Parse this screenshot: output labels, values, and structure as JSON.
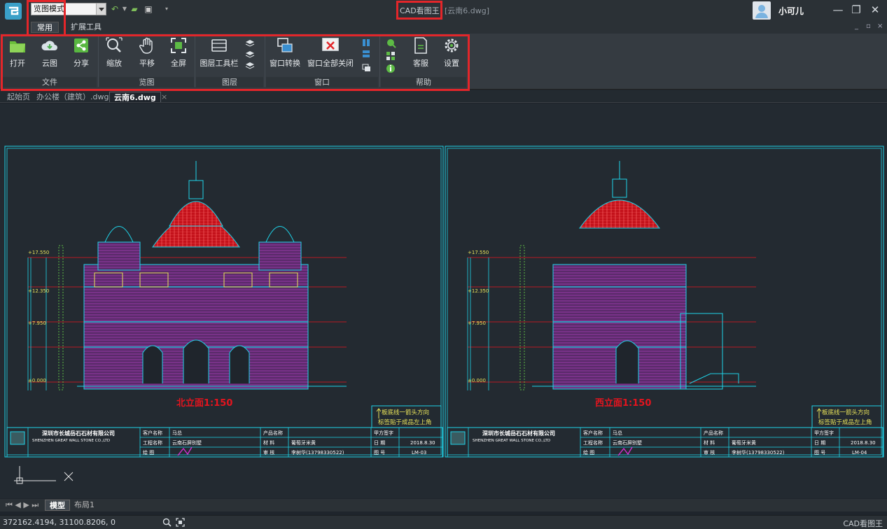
{
  "titlebar": {
    "mode": "览图模式",
    "app_name": "CAD看图王",
    "doc_name": "[云南6.dwg]",
    "username": "小可儿",
    "minimize": "—",
    "restore": "❐",
    "close": "✕"
  },
  "tabs": {
    "common": "常用",
    "extend": "扩展工具"
  },
  "ribbon": {
    "groups": [
      {
        "label": "文件",
        "buttons": [
          "打开",
          "云图",
          "分享"
        ]
      },
      {
        "label": "览图",
        "buttons": [
          "缩放",
          "平移",
          "全屏"
        ]
      },
      {
        "label": "图层",
        "buttons": [
          "图层工具栏"
        ]
      },
      {
        "label": "窗口",
        "buttons": [
          "窗口转换",
          "窗口全部关闭"
        ]
      },
      {
        "label": "帮助",
        "buttons": [
          "客服",
          "设置"
        ]
      }
    ]
  },
  "doc_tabs": [
    "起始页",
    "办公楼（建筑）.dwg",
    "云南6.dwg"
  ],
  "drawing": {
    "left": {
      "title": "北立面1:150",
      "note_line1": "板底线一箭头方向",
      "note_line2": "标签贴于成品左上角",
      "company": "深圳市长城岳石石材有限公司",
      "company_en": "SHENZHEN GREAT WALL STONE CO.,LTD",
      "client_label": "客户名称",
      "client": "马总",
      "product_label": "产品名称",
      "party_sign": "甲方签字",
      "project_label": "工程名称",
      "project": "云南石屏别墅",
      "material_label": "材  料",
      "material": "葡萄牙米黄",
      "date_label": "日  期",
      "date": "2018.8.30",
      "draw_label": "绘  图",
      "review_label": "审  核",
      "reviewer": "李树华(13798330522)",
      "sheet_label": "图  号",
      "sheet": "LM-03"
    },
    "right": {
      "title": "西立面1:150",
      "note_line1": "板底线一箭头方向",
      "note_line2": "标签贴于成品左上角",
      "company": "深圳市长城岳石石材有限公司",
      "company_en": "SHENZHEN GREAT WALL STONE CO.,LTD",
      "client_label": "客户名称",
      "client": "马总",
      "product_label": "产品名称",
      "party_sign": "甲方签字",
      "project_label": "工程名称",
      "project": "云南石屏别墅",
      "material_label": "材  料",
      "material": "葡萄牙米黄",
      "date_label": "日  期",
      "date": "2018.8.30",
      "draw_label": "绘  图",
      "review_label": "审  核",
      "reviewer": "李树华(13798330522)",
      "sheet_label": "图  号",
      "sheet": "LM-04"
    }
  },
  "bottom_tabs": [
    "模型",
    "布局1"
  ],
  "status": {
    "coords": "372162.4194, 31100.8206, 0",
    "app": "CAD看图王"
  },
  "colors": {
    "accent": "#e3262a",
    "cad_cyan": "#1fd3e8",
    "cad_magenta": "#d42fd0",
    "cad_red": "#e5141e"
  }
}
